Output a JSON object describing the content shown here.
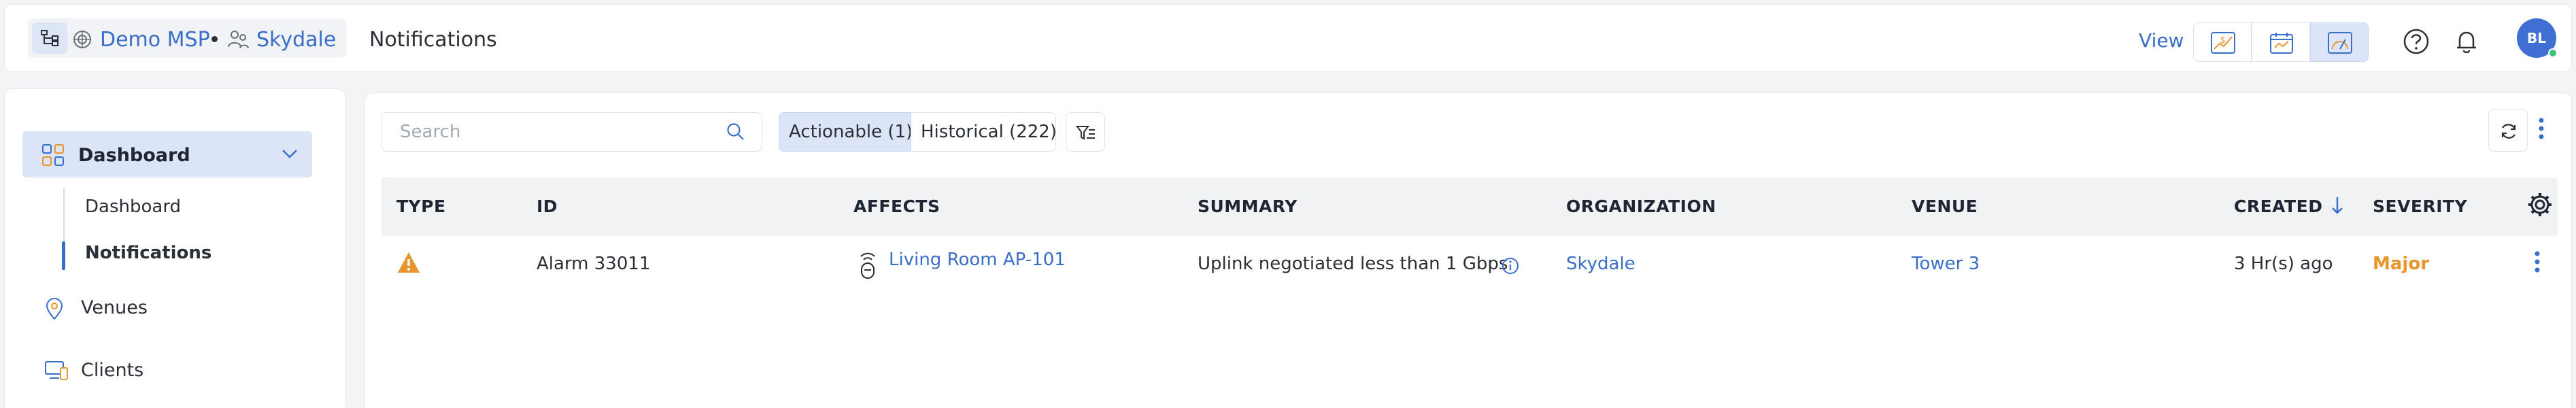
{
  "header": {
    "breadcrumb": {
      "msp_label": "Demo MSP",
      "org_label": "Skydale"
    },
    "page_title": "Notifications",
    "view_label": "View",
    "view_options": [
      "dollar-chart-view-icon",
      "calendar-view-icon",
      "gauge-view-icon"
    ],
    "active_view_index": 2,
    "avatar_initials": "BL",
    "accent_color": "#3a6fc9"
  },
  "sidebar": {
    "dashboard_label": "Dashboard",
    "sub_items": [
      {
        "label": "Dashboard",
        "active": false
      },
      {
        "label": "Notifications",
        "active": true
      }
    ],
    "items": [
      {
        "label": "Venues",
        "icon": "location-pin-icon"
      },
      {
        "label": "Clients",
        "icon": "devices-icon"
      }
    ]
  },
  "toolbar": {
    "search_placeholder": "Search",
    "search_value": "",
    "tabs": [
      {
        "label": "Actionable (1)",
        "active": true
      },
      {
        "label": "Historical (222)",
        "active": false
      }
    ]
  },
  "table": {
    "columns": [
      "TYPE",
      "ID",
      "AFFECTS",
      "SUMMARY",
      "ORGANIZATION",
      "VENUE",
      "CREATED",
      "SEVERITY"
    ],
    "sort_column": "CREATED",
    "sort_direction": "descending",
    "rows": [
      {
        "type_icon": "warning-triangle-icon",
        "id": "Alarm 33011",
        "affects": "Living Room AP-101",
        "summary": "Uplink negotiated less than 1 Gbps",
        "organization": "Skydale",
        "venue": "Tower 3",
        "created": "3 Hr(s) ago",
        "severity": "Major",
        "severity_color": "#e8952d"
      }
    ]
  }
}
